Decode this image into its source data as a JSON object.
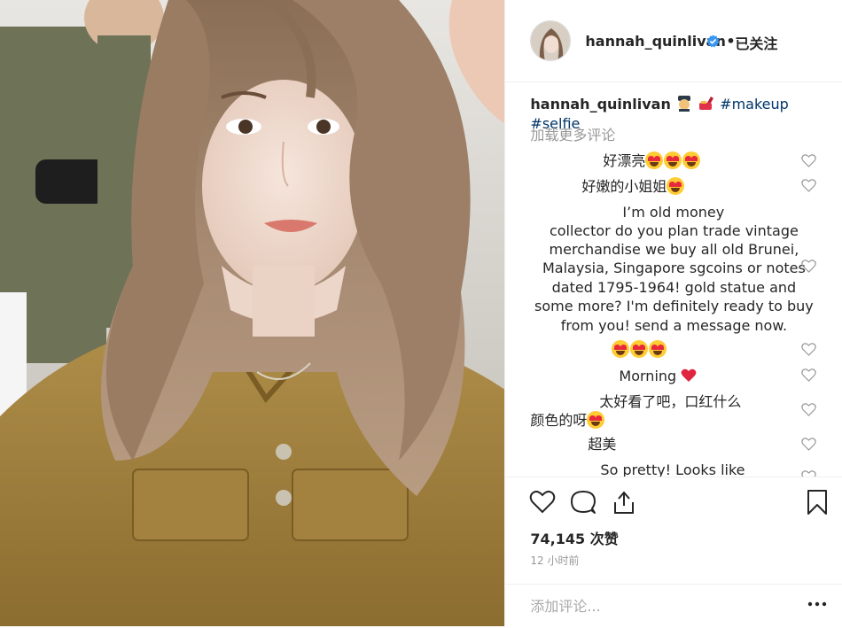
{
  "post": {
    "username": "hannah_quinlivan",
    "follow_separator": "•",
    "follow_label": "已关注",
    "caption": {
      "user": "hannah_quinlivan",
      "tags": "#makeup #selfie"
    },
    "load_more_label": "加载更多评论",
    "comments": [
      {
        "lines": [
          "好漂亮"
        ],
        "emoji_count": 3
      },
      {
        "lines": [
          "好嫩的小姐姐"
        ],
        "emoji_count": 1
      },
      {
        "lines": [
          "I’m old money",
          "collector do you plan trade vintage",
          "merchandise we buy all old Brunei,",
          "Malaysia, Singapore sgcoins or notes",
          "dated 1795-1964! gold statue and",
          "some more? I'm definitely ready to buy",
          "from you! send a message now."
        ]
      },
      {
        "lines": [
          ""
        ],
        "emoji_count": 3
      },
      {
        "lines": [
          "Morning"
        ]
      },
      {
        "lines": [
          "太好看了吧，口红什么",
          "颜色的呀"
        ]
      },
      {
        "lines": [
          "超美"
        ]
      },
      {
        "lines": [
          "So pretty! Looks like"
        ]
      }
    ],
    "likes_label": "74,145 次赞",
    "timestamp": "12 小时前",
    "comment_placeholder": "添加评论..."
  },
  "icons": {
    "verified": "verified-badge-icon",
    "like": "heart-icon",
    "comment": "comment-bubble-icon",
    "share": "share-icon",
    "save": "bookmark-icon",
    "more": "more-options-icon"
  },
  "colors": {
    "text": "#262626",
    "muted": "#999999",
    "hashtag": "#003569",
    "verified": "#3897f0",
    "border": "#efefef"
  }
}
